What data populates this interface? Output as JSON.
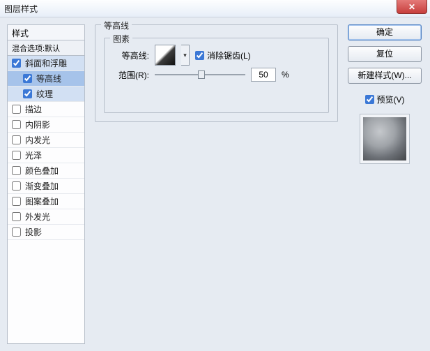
{
  "window": {
    "title": "图层样式"
  },
  "sidebar": {
    "header": "样式",
    "blend": "混合选项:默认",
    "items": [
      {
        "label": "斜面和浮雕",
        "checked": true,
        "selected": "light",
        "indent": false
      },
      {
        "label": "等高线",
        "checked": true,
        "selected": "dark",
        "indent": true
      },
      {
        "label": "纹理",
        "checked": true,
        "selected": "light",
        "indent": true
      },
      {
        "label": "描边",
        "checked": false,
        "selected": "",
        "indent": false
      },
      {
        "label": "内阴影",
        "checked": false,
        "selected": "",
        "indent": false
      },
      {
        "label": "内发光",
        "checked": false,
        "selected": "",
        "indent": false
      },
      {
        "label": "光泽",
        "checked": false,
        "selected": "",
        "indent": false
      },
      {
        "label": "颜色叠加",
        "checked": false,
        "selected": "",
        "indent": false
      },
      {
        "label": "渐变叠加",
        "checked": false,
        "selected": "",
        "indent": false
      },
      {
        "label": "图案叠加",
        "checked": false,
        "selected": "",
        "indent": false
      },
      {
        "label": "外发光",
        "checked": false,
        "selected": "",
        "indent": false
      },
      {
        "label": "投影",
        "checked": false,
        "selected": "",
        "indent": false
      }
    ]
  },
  "panel": {
    "group_title": "等高线",
    "elements_title": "图素",
    "contour_label": "等高线:",
    "antialias_label": "消除锯齿(L)",
    "antialias_checked": true,
    "range_label": "范围(R):",
    "range_value": "50",
    "range_unit": "%"
  },
  "buttons": {
    "ok": "确定",
    "reset": "复位",
    "new_style": "新建样式(W)...",
    "preview_label": "预览(V)",
    "preview_checked": true
  }
}
